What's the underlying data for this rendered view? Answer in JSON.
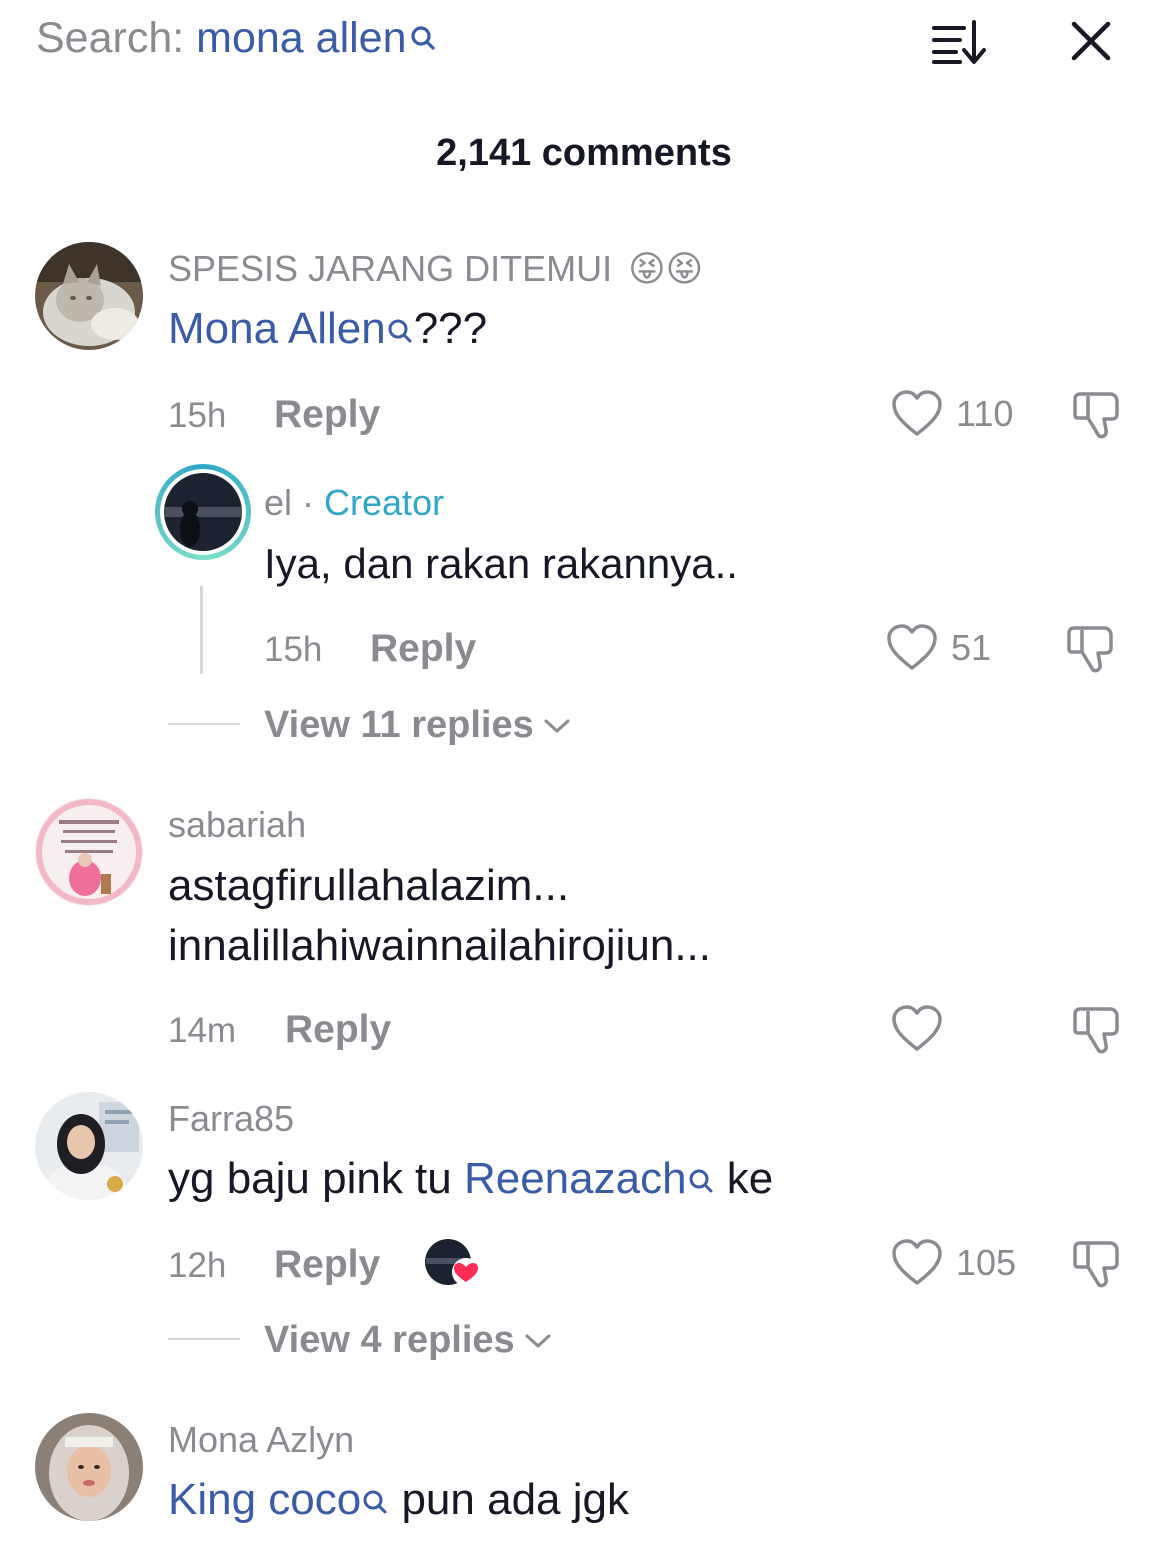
{
  "header": {
    "search_prefix": "Search: ",
    "search_term": "mona allen",
    "sort_icon": "sort-icon",
    "close_icon": "close-icon"
  },
  "comment_count": "2,141 comments",
  "comments": [
    {
      "username": "SPESIS JARANG DITEMUI",
      "emoji": "😝😝",
      "mention": "Mona Allen",
      "text": "???",
      "time": "15h",
      "reply_label": "Reply",
      "likes": "110",
      "reply": {
        "username": "el",
        "separator": " · ",
        "badge": "Creator",
        "text": "Iya, dan rakan rakannya..",
        "time": "15h",
        "reply_label": "Reply",
        "likes": "51"
      },
      "view_replies": "View 11 replies"
    },
    {
      "username": "sabariah",
      "line1": "astagfirullahalazim...",
      "line2": "innalillahiwainnailahirojiun...",
      "time": "14m",
      "reply_label": "Reply"
    },
    {
      "username": "Farra85",
      "text_before": "yg baju pink tu ",
      "mention": "Reenazach",
      "text_after": " ke",
      "time": "12h",
      "reply_label": "Reply",
      "likes": "105",
      "view_replies": "View 4 replies"
    },
    {
      "username": "Mona Azlyn",
      "mention": "King coco",
      "text_after": " pun ada jgk"
    }
  ],
  "colors": {
    "mention": "#3a5ca8",
    "creator": "#2fa7c9",
    "muted": "#8a8b91",
    "heart_badge": "#fe2c55"
  }
}
